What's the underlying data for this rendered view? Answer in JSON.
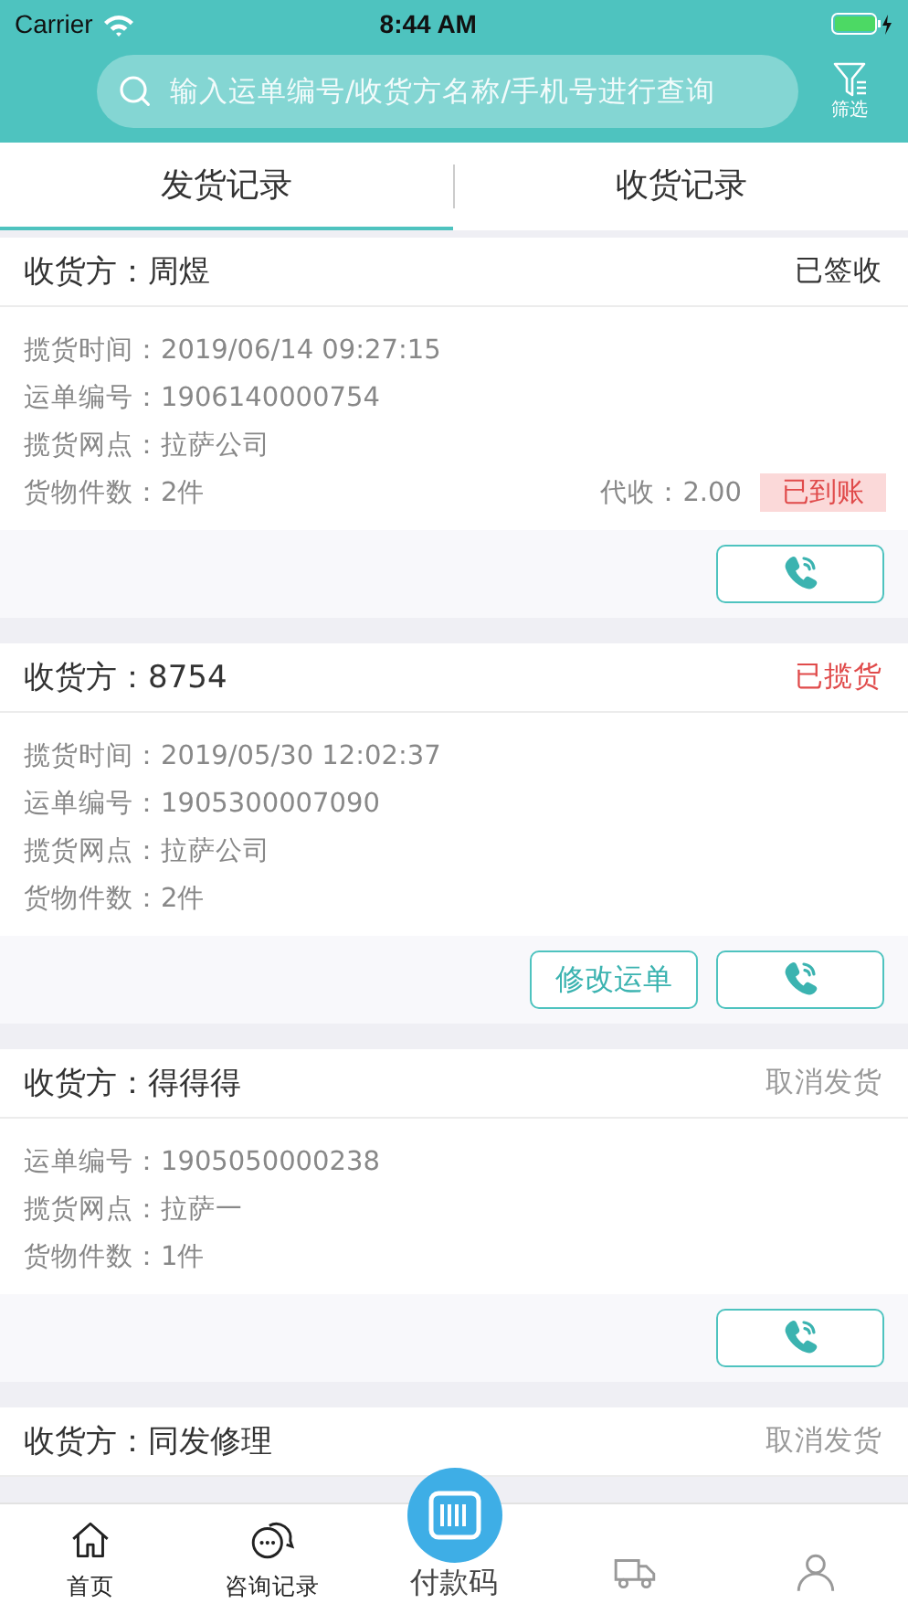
{
  "status_bar": {
    "carrier": "Carrier",
    "time": "8:44 AM"
  },
  "search": {
    "placeholder": "输入运单编号/收货方名称/手机号进行查询"
  },
  "filter": {
    "label": "筛选"
  },
  "tabs": [
    {
      "label": "发货记录",
      "selected": true
    },
    {
      "label": "收货记录",
      "selected": false
    }
  ],
  "cards": [
    {
      "receiver_label": "收货方：",
      "receiver": "周煜",
      "status": "已签收",
      "kind": "signed",
      "fields": [
        {
          "label": "揽货时间：",
          "value": "2019/06/14 09:27:15"
        },
        {
          "label": "运单编号：",
          "value": "1906140000754"
        },
        {
          "label": "揽货网点：",
          "value": "拉萨公司"
        },
        {
          "label": "货物件数：",
          "value": "2件"
        }
      ],
      "collect": {
        "text": "代收：2.00",
        "badge": "已到账"
      },
      "actions": [
        {
          "kind": "call"
        }
      ]
    },
    {
      "receiver_label": "收货方：",
      "receiver": "8754",
      "status": "已揽货",
      "kind": "collected",
      "fields": [
        {
          "label": "揽货时间：",
          "value": "2019/05/30 12:02:37"
        },
        {
          "label": "运单编号：",
          "value": "1905300007090"
        },
        {
          "label": "揽货网点：",
          "value": "拉萨公司"
        },
        {
          "label": "货物件数：",
          "value": "2件"
        }
      ],
      "actions": [
        {
          "kind": "text",
          "label": "修改运单"
        },
        {
          "kind": "call"
        }
      ]
    },
    {
      "receiver_label": "收货方：",
      "receiver": "得得得",
      "status": "取消发货",
      "kind": "cancelled",
      "fields": [
        {
          "label": "运单编号：",
          "value": "1905050000238"
        },
        {
          "label": "揽货网点：",
          "value": "拉萨一"
        },
        {
          "label": "货物件数：",
          "value": "1件"
        }
      ],
      "actions": [
        {
          "kind": "call"
        }
      ]
    },
    {
      "receiver_label": "收货方：",
      "receiver": "同发修理",
      "status": "取消发货",
      "kind": "cancelled"
    }
  ],
  "tab_bar": [
    {
      "kind": "home",
      "label": "首页"
    },
    {
      "kind": "chat",
      "label": "咨询记录"
    },
    {
      "kind": "code",
      "label": "付款码"
    },
    {
      "kind": "truck"
    },
    {
      "kind": "user"
    }
  ]
}
